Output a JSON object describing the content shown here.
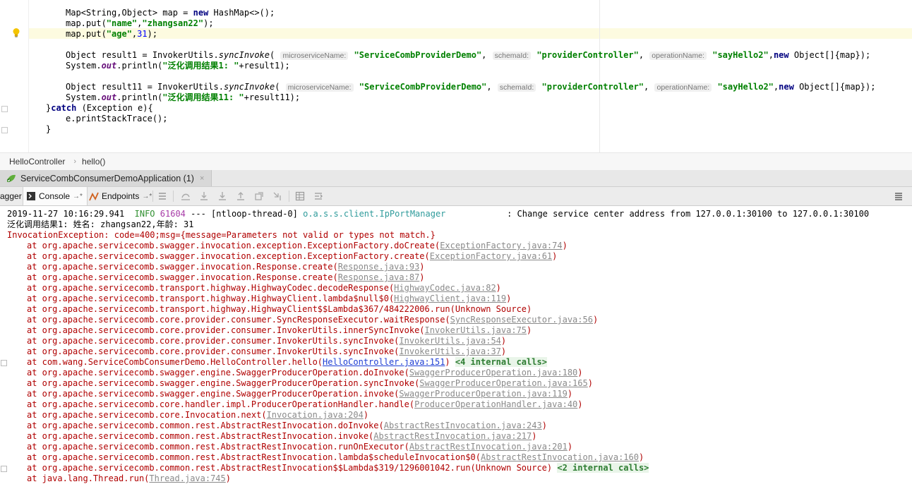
{
  "editor": {
    "lines": [
      "Map<String,Object> map = new HashMap<>();",
      "map.put(\"name\",\"zhangsan22\");",
      "map.put(\"age\",31);",
      "",
      "Object result1 = InvokerUtils.syncInvoke( microserviceName: \"ServiceCombProviderDemo\", schemaId: \"providerController\", operationName: \"sayHello2\",new Object[]{map});",
      "System.out.println(\"泛化调用结果1: \"+result1);",
      "",
      "Object result11 = InvokerUtils.syncInvoke( microserviceName: \"ServiceCombProviderDemo\", schemaId: \"providerController\", operationName: \"sayHello2\",new Object[]{map});",
      "System.out.println(\"泛化调用结果11: \"+result11);",
      "}catch (Exception e){",
      "e.printStackTrace();",
      "}"
    ],
    "hints": {
      "microservice_name": "microserviceName:",
      "schema_id": "schemaId:",
      "operation_name": "operationName:"
    },
    "strings": {
      "name_key": "\"name\"",
      "name_val": "\"zhangsan22\"",
      "age_key": "\"age\"",
      "age_val": "31",
      "provider": "\"ServiceCombProviderDemo\"",
      "schema": "\"providerController\"",
      "op": "\"sayHello2\"",
      "msg1": "\"泛化调用结果1: \"",
      "msg11": "\"泛化调用结果11: \""
    }
  },
  "breadcrumb": {
    "class_name": "HelloController",
    "method_name": "hello()"
  },
  "run_tab": {
    "label": "ServiceCombConsumerDemoApplication (1)",
    "close": "×"
  },
  "toolbar": {
    "swagger_label": "agger",
    "console_label": "Console",
    "endpoints_label": "Endpoints",
    "pin": "→*"
  },
  "console": {
    "log_line": {
      "timestamp": "2019-11-27 10:16:29.941",
      "level": "INFO",
      "pid": "61604",
      "sep": "---",
      "thread": "[ntloop-thread-0]",
      "logger": "o.a.s.s.client.IpPortManager",
      "message": ": Change service center address from 127.0.0.1:30100 to 127.0.0.1:30100"
    },
    "result_line": "泛化调用结果1: 姓名: zhangsan22,年龄: 31",
    "exception_line": "InvocationException: code=400;msg={message=Parameters not valid or types not match.}",
    "frames": [
      {
        "text": "at org.apache.servicecomb.swagger.invocation.exception.ExceptionFactory.doCreate(",
        "link": "ExceptionFactory.java:74",
        "tail": ")"
      },
      {
        "text": "at org.apache.servicecomb.swagger.invocation.exception.ExceptionFactory.create(",
        "link": "ExceptionFactory.java:61",
        "tail": ")"
      },
      {
        "text": "at org.apache.servicecomb.swagger.invocation.Response.create(",
        "link": "Response.java:93",
        "tail": ")"
      },
      {
        "text": "at org.apache.servicecomb.swagger.invocation.Response.create(",
        "link": "Response.java:87",
        "tail": ")"
      },
      {
        "text": "at org.apache.servicecomb.transport.highway.HighwayCodec.decodeResponse(",
        "link": "HighwayCodec.java:82",
        "tail": ")"
      },
      {
        "text": "at org.apache.servicecomb.transport.highway.HighwayClient.lambda$null$0(",
        "link": "HighwayClient.java:119",
        "tail": ")"
      },
      {
        "text": "at org.apache.servicecomb.transport.highway.HighwayClient$$Lambda$367/484222006.run(Unknown Source)",
        "link": "",
        "tail": ""
      },
      {
        "text": "at org.apache.servicecomb.core.provider.consumer.SyncResponseExecutor.waitResponse(",
        "link": "SyncResponseExecutor.java:56",
        "tail": ")"
      },
      {
        "text": "at org.apache.servicecomb.core.provider.consumer.InvokerUtils.innerSyncInvoke(",
        "link": "InvokerUtils.java:75",
        "tail": ")"
      },
      {
        "text": "at org.apache.servicecomb.core.provider.consumer.InvokerUtils.syncInvoke(",
        "link": "InvokerUtils.java:54",
        "tail": ")"
      },
      {
        "text": "at org.apache.servicecomb.core.provider.consumer.InvokerUtils.syncInvoke(",
        "link": "InvokerUtils.java:37",
        "tail": ")"
      },
      {
        "text": "at com.wang.ServiceCombConsumerDemo.HelloController.hello(",
        "link": "HelloController.java:151",
        "tail": ") ",
        "internal": "<4 internal calls>",
        "blue": true
      },
      {
        "text": "at org.apache.servicecomb.swagger.engine.SwaggerProducerOperation.doInvoke(",
        "link": "SwaggerProducerOperation.java:180",
        "tail": ")"
      },
      {
        "text": "at org.apache.servicecomb.swagger.engine.SwaggerProducerOperation.syncInvoke(",
        "link": "SwaggerProducerOperation.java:165",
        "tail": ")"
      },
      {
        "text": "at org.apache.servicecomb.swagger.engine.SwaggerProducerOperation.invoke(",
        "link": "SwaggerProducerOperation.java:119",
        "tail": ")"
      },
      {
        "text": "at org.apache.servicecomb.core.handler.impl.ProducerOperationHandler.handle(",
        "link": "ProducerOperationHandler.java:40",
        "tail": ")"
      },
      {
        "text": "at org.apache.servicecomb.core.Invocation.next(",
        "link": "Invocation.java:204",
        "tail": ")"
      },
      {
        "text": "at org.apache.servicecomb.common.rest.AbstractRestInvocation.doInvoke(",
        "link": "AbstractRestInvocation.java:243",
        "tail": ")"
      },
      {
        "text": "at org.apache.servicecomb.common.rest.AbstractRestInvocation.invoke(",
        "link": "AbstractRestInvocation.java:217",
        "tail": ")"
      },
      {
        "text": "at org.apache.servicecomb.common.rest.AbstractRestInvocation.runOnExecutor(",
        "link": "AbstractRestInvocation.java:201",
        "tail": ")"
      },
      {
        "text": "at org.apache.servicecomb.common.rest.AbstractRestInvocation.lambda$scheduleInvocation$0(",
        "link": "AbstractRestInvocation.java:160",
        "tail": ")"
      },
      {
        "text": "at org.apache.servicecomb.common.rest.AbstractRestInvocation$$Lambda$319/1296001042.run(Unknown Source) ",
        "link": "",
        "tail": "",
        "internal": "<2 internal calls>"
      },
      {
        "text": "at java.lang.Thread.run(",
        "link": "Thread.java:745",
        "tail": ")"
      }
    ]
  }
}
